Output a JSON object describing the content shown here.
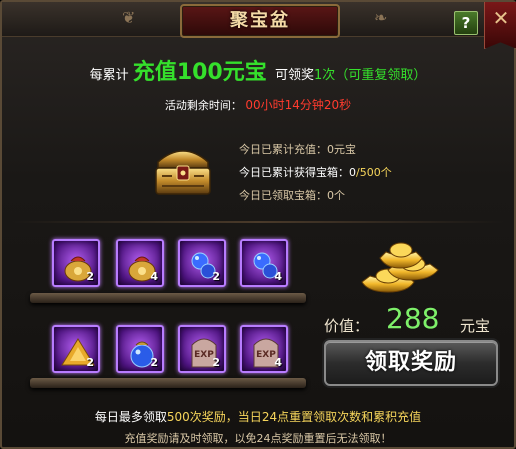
{
  "window": {
    "title": "聚宝盆",
    "help_label": "?",
    "close_label": "✕"
  },
  "promo": {
    "prefix": "每累计",
    "highlight": "充值100元宝",
    "middle": "可领奖",
    "count": "1次",
    "suffix": "（可重复领取）"
  },
  "timer": {
    "label": "活动剩余时间：",
    "value": "00小时14分钟20秒"
  },
  "stats": {
    "recharge_label": "今日已累计充值：",
    "recharge_value": "0元宝",
    "boxes_label": "今日已累计获得宝箱：",
    "boxes_value": "0",
    "boxes_total": "/500个",
    "claimed_label": "今日已领取宝箱：",
    "claimed_value": "0个"
  },
  "items": [
    {
      "icon": "treasure-bag-icon",
      "count": "2"
    },
    {
      "icon": "treasure-bag-icon",
      "count": "4"
    },
    {
      "icon": "blue-potion-icon",
      "count": "2"
    },
    {
      "icon": "blue-potion-icon",
      "count": "4"
    },
    {
      "icon": "gold-pile-icon",
      "count": "2"
    },
    {
      "icon": "blue-pouch-icon",
      "count": "2"
    },
    {
      "icon": "exp-tombstone-icon",
      "count": "2"
    },
    {
      "icon": "exp-tombstone-icon",
      "count": "4"
    }
  ],
  "reward": {
    "price_label": "价值：",
    "price_value": "288",
    "price_unit": "元宝",
    "claim_label": "领取奖励"
  },
  "footer": {
    "line1_a": "每日最多领取",
    "line1_b": "500次奖励，当日",
    "line1_c": "24点重置领取次数和累积充值",
    "line2": "充值奖励请及时领取，以免24点奖励重置后无法领取！"
  },
  "colors": {
    "accent_green": "#35e02c",
    "accent_red": "#ff3b2e",
    "accent_gold": "#f6d55b",
    "slot_purple": "#b87cff"
  }
}
